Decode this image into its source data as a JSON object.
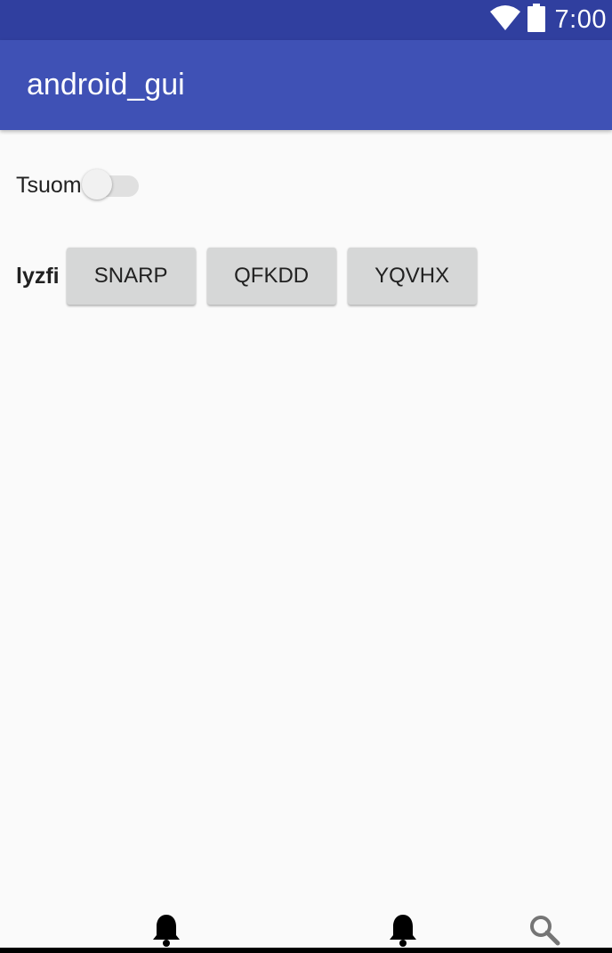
{
  "status_bar": {
    "time": "7:00",
    "icons": [
      "wifi-icon",
      "battery-icon"
    ],
    "color": "#303F9F"
  },
  "app_bar": {
    "title": "android_gui",
    "color": "#3F51B5"
  },
  "switch_row": {
    "label": "Tsuom",
    "checked": false
  },
  "button_row": {
    "label": "lyzfi",
    "buttons": [
      "SNARP",
      "QFKDD",
      "YQVHX"
    ]
  },
  "bottom_nav": {
    "icons": [
      "bell-icon",
      "bell-icon",
      "search-icon"
    ]
  }
}
